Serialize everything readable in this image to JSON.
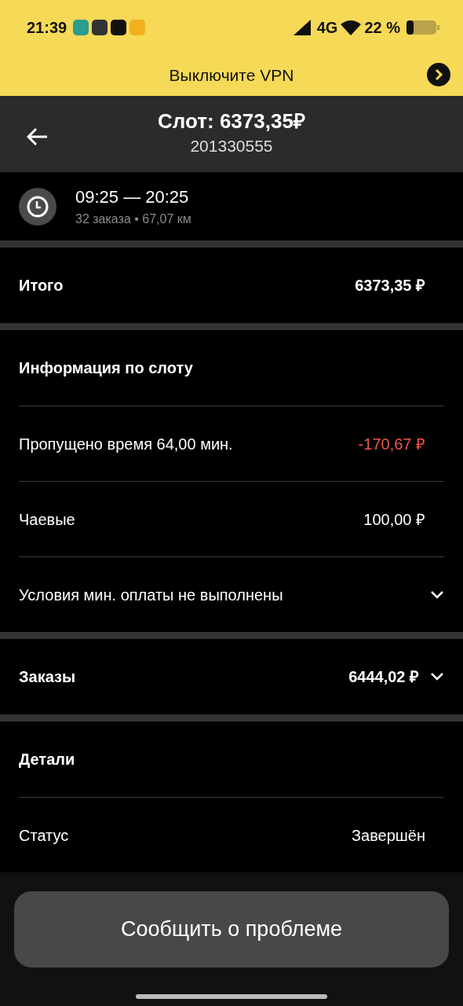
{
  "status_bar": {
    "time": "21:39",
    "network": "4G",
    "battery": "22 %"
  },
  "banner": {
    "text": "Выключите VPN"
  },
  "header": {
    "title": "Слот: 6373,35₽",
    "subtitle": "201330555"
  },
  "shift": {
    "time_range": "09:25 — 20:25",
    "summary": "32 заказа • 67,07 км"
  },
  "sections": [
    {
      "rows": [
        {
          "kind": "summary",
          "label": "Итого",
          "value": "6373,35 ₽",
          "negative": false
        }
      ]
    },
    {
      "title": "Информация по слоту",
      "rows": [
        {
          "kind": "line",
          "label": "Пропущено время 64,00 мин.",
          "value": "-170,67 ₽",
          "negative": true
        },
        {
          "kind": "line",
          "label": "Чаевые",
          "value": "100,00 ₽",
          "negative": false
        },
        {
          "kind": "line",
          "label": "Условия мин. оплаты не выполнены",
          "expanded": false
        }
      ]
    },
    {
      "rows": [
        {
          "kind": "summary",
          "label": "Заказы",
          "value": "6444,02 ₽",
          "negative": false,
          "expanded": false
        }
      ]
    },
    {
      "title": "Детали",
      "rows": [
        {
          "kind": "line",
          "label": "Статус",
          "value": "Завершён",
          "negative": false
        }
      ]
    }
  ],
  "footer_button": {
    "label": "Сообщить о проблеме"
  }
}
